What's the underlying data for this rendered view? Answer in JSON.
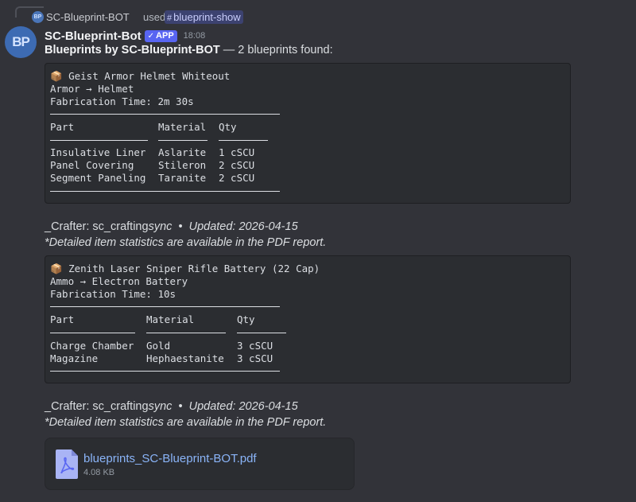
{
  "reply": {
    "avatar_initials": "BP",
    "author": "SC-Blueprint-BOT",
    "used": "used",
    "command_icon": "#",
    "command": "blueprint-show"
  },
  "message": {
    "avatar_initials": "BP",
    "username": "SC-Blueprint-Bot",
    "badge_check": "✓",
    "badge": "APP",
    "timestamp": "18:08",
    "summary_bold": "Blueprints by SC-Blueprint-BOT",
    "summary_rest": " — 2 blueprints found:"
  },
  "blueprints": [
    {
      "box_icon": "📦",
      "title": "Geist Armor Helmet Whiteout",
      "category": "Armor → Helmet",
      "fabrication": "Fabrication Time: 2m 30s",
      "headers": [
        "Part",
        "Material",
        "Qty"
      ],
      "rows": [
        [
          "Insulative Liner",
          "Aslarite",
          "1 cSCU"
        ],
        [
          "Panel Covering",
          "Stileron",
          "2 cSCU"
        ],
        [
          "Segment Paneling",
          "Taranite",
          "2 cSCU"
        ]
      ],
      "crafter_prefix": "_Crafter: sc_crafting",
      "crafter_italic": "sync",
      "updated": "Updated: 2026-04-15",
      "note": "*Detailed item statistics are available in the PDF report."
    },
    {
      "box_icon": "📦",
      "title": "Zenith Laser Sniper Rifle Battery (22 Cap)",
      "category": "Ammo → Electron Battery",
      "fabrication": "Fabrication Time: 10s",
      "headers": [
        "Part",
        "Material",
        "Qty"
      ],
      "rows": [
        [
          "Charge Chamber",
          "Gold",
          "3 cSCU"
        ],
        [
          "Magazine",
          "Hephaestanite",
          "3 cSCU"
        ]
      ],
      "crafter_prefix": "_Crafter: sc_crafting",
      "crafter_italic": "sync",
      "updated": "Updated: 2026-04-15",
      "note": "*Detailed item statistics are available in the PDF report."
    }
  ],
  "separator": "•",
  "attachment": {
    "icon": "pdf-file-icon",
    "filename": "blueprints_SC-Blueprint-BOT.pdf",
    "size": "4.08 KB"
  },
  "colors": {
    "accent": "#5865f2",
    "link": "#8ab4f8",
    "background": "#323339",
    "code_bg": "#2b2d31"
  }
}
